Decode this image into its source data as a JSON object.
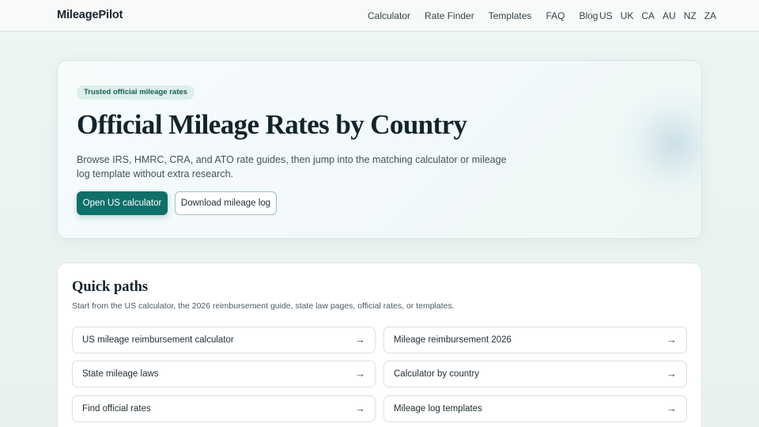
{
  "nav": {
    "brand": "MileagePilot",
    "links": [
      "Calculator",
      "Rate Finder",
      "Templates",
      "FAQ",
      "Blog"
    ],
    "countries": [
      "US",
      "UK",
      "CA",
      "AU",
      "NZ",
      "ZA"
    ]
  },
  "hero": {
    "badge": "Trusted official mileage rates",
    "title": "Official Mileage Rates by Country",
    "description": "Browse IRS, HMRC, CRA, and ATO rate guides, then jump into the matching calculator or mileage log template without extra research.",
    "primary_button": "Open US calculator",
    "secondary_button": "Download mileage log"
  },
  "quick_paths": {
    "title": "Quick paths",
    "description": "Start from the US calculator, the 2026 reimbursement guide, state law pages, official rates, or templates.",
    "items": [
      {
        "label": "US mileage reimbursement calculator",
        "arrow": "→"
      },
      {
        "label": "Mileage reimbursement 2026",
        "arrow": "→"
      },
      {
        "label": "State mileage laws",
        "arrow": "→"
      },
      {
        "label": "Calculator by country",
        "arrow": "→"
      },
      {
        "label": "Find official rates",
        "arrow": "→"
      },
      {
        "label": "Mileage log templates",
        "arrow": "→"
      }
    ]
  },
  "colors": {
    "accent": "#0f6f69",
    "badge_bg": "#dcefe9",
    "page_bg": "#eef6f4"
  }
}
